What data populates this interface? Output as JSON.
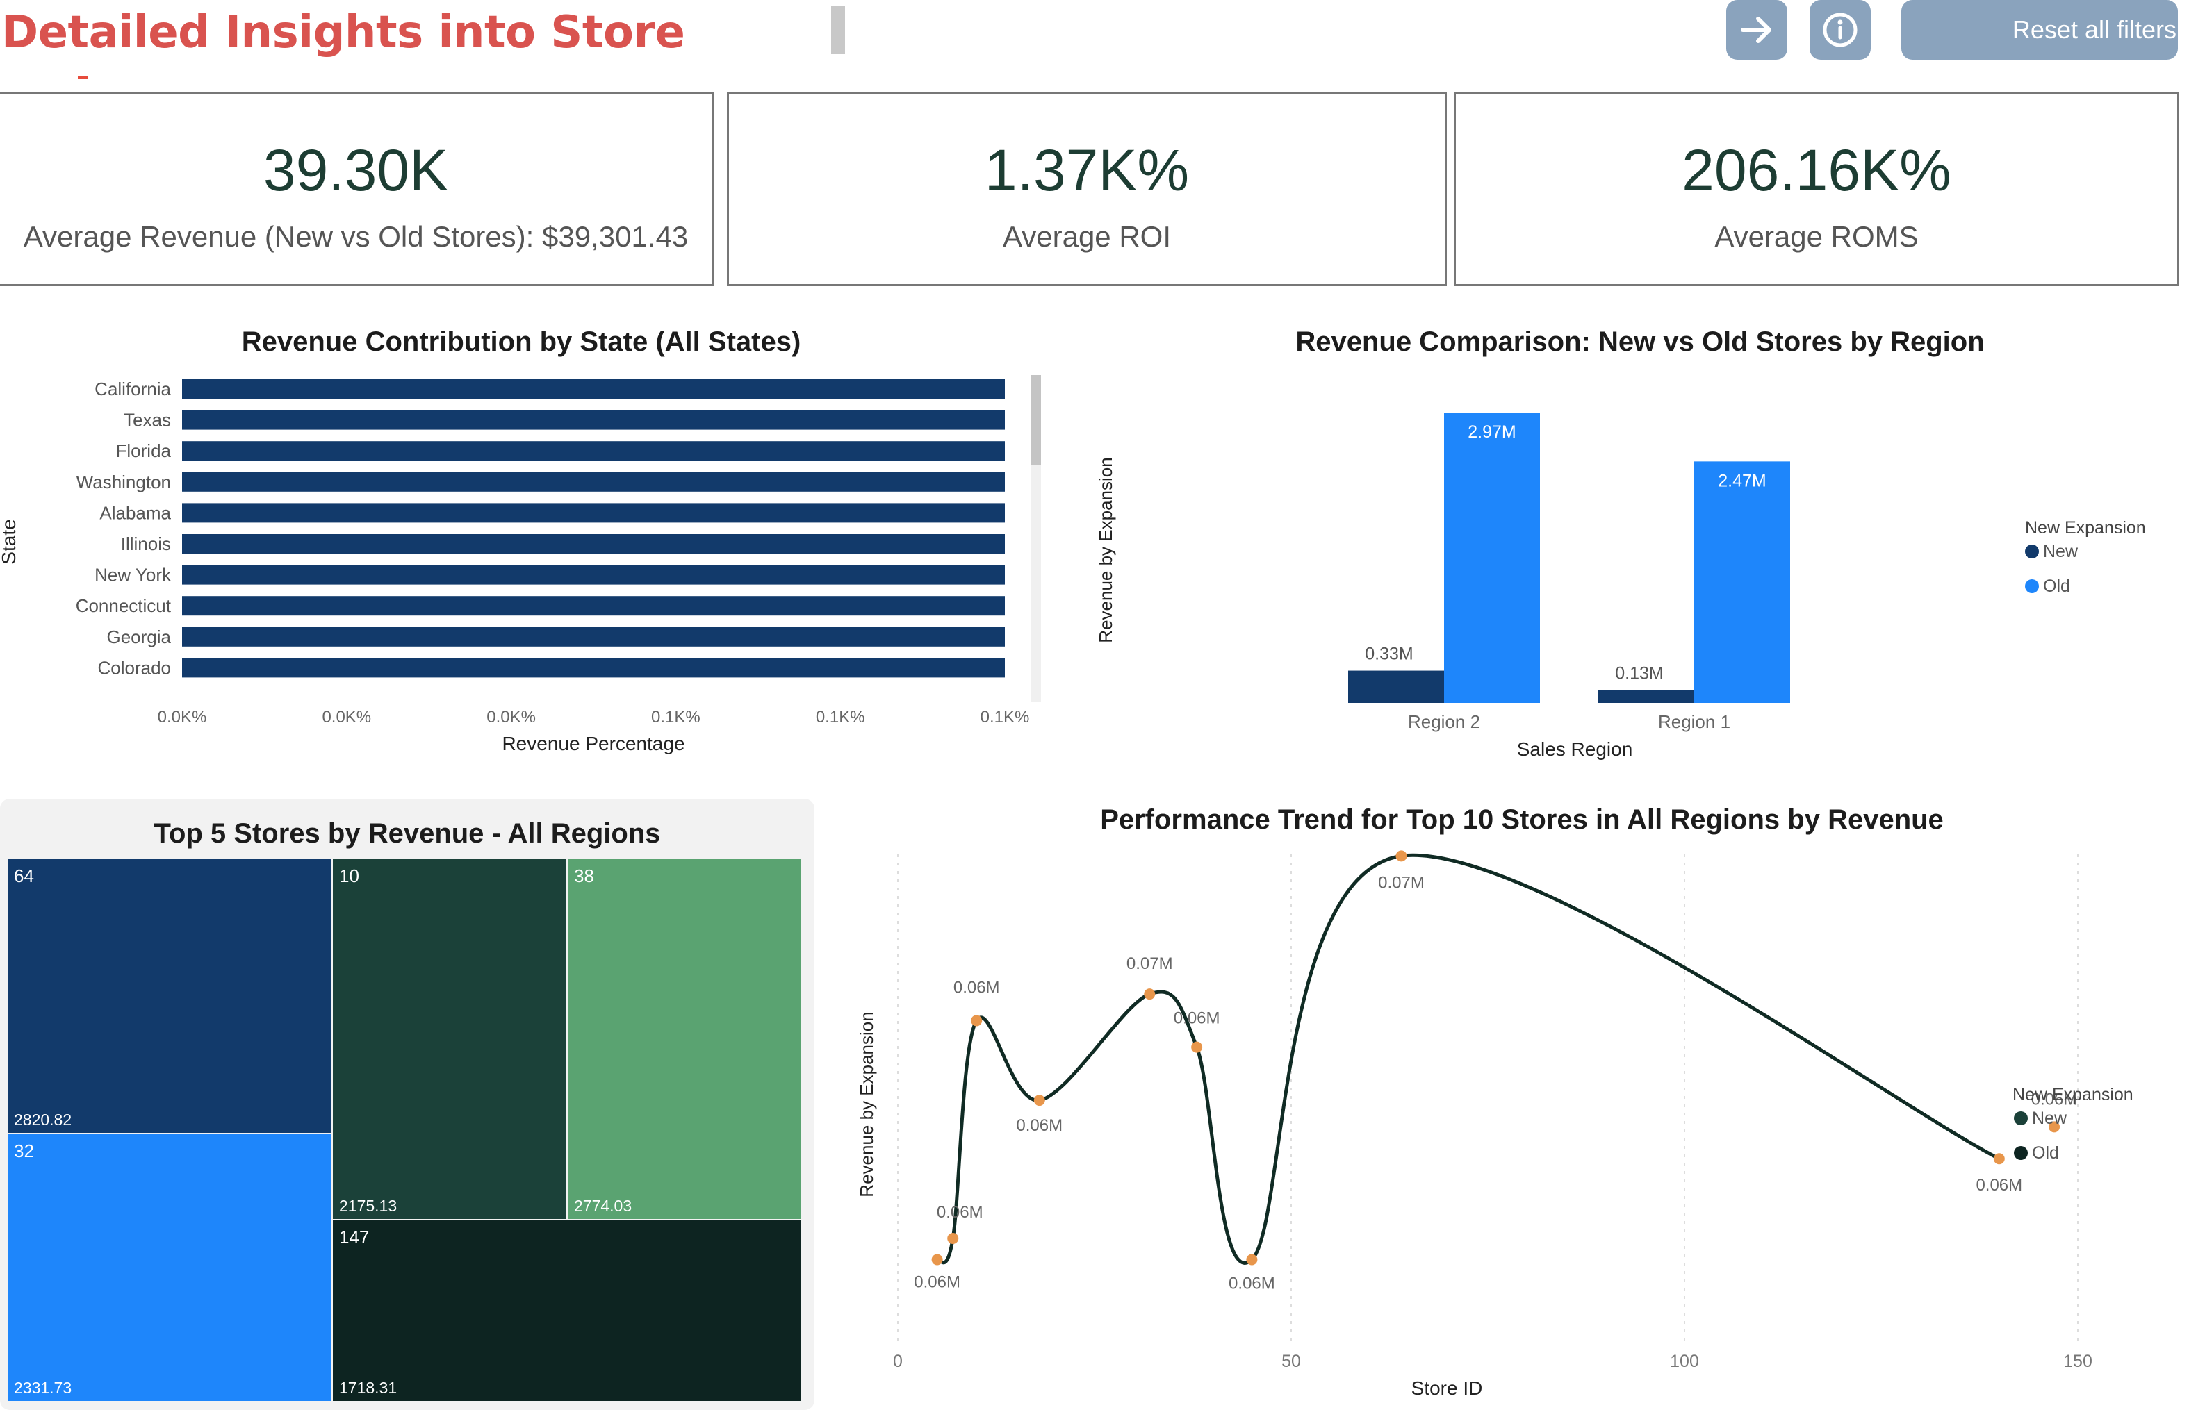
{
  "header": {
    "title": "Detailed Insights into Store",
    "reset_label": "Reset all filters",
    "nav_icon": "arrow-right-icon",
    "info_icon": "info-icon"
  },
  "kpis": [
    {
      "value": "39.30K",
      "label": "Average Revenue (New vs Old Stores): $39,301.43"
    },
    {
      "value": "1.37K%",
      "label": "Average ROI"
    },
    {
      "value": "206.16K%",
      "label": "Average ROMS"
    }
  ],
  "colors": {
    "title_red": "#d9534f",
    "navy": "#123a6b",
    "bright_blue": "#1e86fb",
    "line_dark": "#102b24",
    "point_orange": "#e8964b",
    "tm_dark_green": "#1b4139",
    "tm_light_green": "#5aa371",
    "tm_darkest": "#0d2421"
  },
  "chart_data": [
    {
      "type": "bar",
      "orientation": "horizontal",
      "title": "Revenue Contribution by State (All States)",
      "xlabel": "Revenue Percentage",
      "ylabel": "State",
      "categories": [
        "California",
        "Texas",
        "Florida",
        "Washington",
        "Alabama",
        "Illinois",
        "New York",
        "Connecticut",
        "Georgia",
        "Colorado"
      ],
      "values": [
        0.1,
        0.1,
        0.1,
        0.1,
        0.1,
        0.1,
        0.1,
        0.1,
        0.1,
        0.1
      ],
      "xticks": [
        "0.0K%",
        "0.0K%",
        "0.0K%",
        "0.1K%",
        "0.1K%",
        "0.1K%"
      ],
      "grid": false
    },
    {
      "type": "bar",
      "title": "Revenue Comparison: New vs Old Stores by Region",
      "xlabel": "Sales Region",
      "ylabel": "Revenue by Expansion",
      "categories": [
        "Region 2",
        "Region 1"
      ],
      "legend_title": "New Expansion",
      "legend_position": "right",
      "series": [
        {
          "name": "New",
          "values": [
            0.33,
            0.13
          ],
          "labels": [
            "0.33M",
            "0.13M"
          ]
        },
        {
          "name": "Old",
          "values": [
            2.97,
            2.47
          ],
          "labels": [
            "2.97M",
            "2.47M"
          ]
        }
      ],
      "ylim": [
        0,
        3.4
      ]
    },
    {
      "type": "treemap",
      "title": "Top 5 Stores by Revenue - All Regions",
      "items": [
        {
          "store": "64",
          "value": 2820.82
        },
        {
          "store": "32",
          "value": 2331.73
        },
        {
          "store": "10",
          "value": 2175.13
        },
        {
          "store": "38",
          "value": 2774.03
        },
        {
          "store": "147",
          "value": 1718.31
        }
      ]
    },
    {
      "type": "line",
      "title": "Performance Trend for Top 10 Stores in All Regions by Revenue",
      "xlabel": "Store ID",
      "ylabel": "Revenue by Expansion",
      "legend_title": "New Expansion",
      "legend_position": "right",
      "xlim": [
        0,
        150
      ],
      "ylim": [
        0.055,
        0.072
      ],
      "xticks": [
        "0",
        "50",
        "100",
        "150"
      ],
      "series": [
        {
          "name": "New",
          "x": [
            5,
            7,
            10,
            18,
            32,
            38,
            45,
            64,
            140
          ],
          "y": [
            0.057,
            0.0578,
            0.066,
            0.063,
            0.067,
            0.065,
            0.057,
            0.0722,
            0.0608
          ],
          "labels": [
            "0.06M",
            "0.06M",
            "0.06M",
            "0.06M",
            "0.07M",
            "0.06M",
            "0.06M",
            "0.07M",
            "0.06M"
          ]
        },
        {
          "name": "Old",
          "x": [
            147
          ],
          "y": [
            0.062
          ],
          "labels": [
            "0.06M"
          ]
        }
      ]
    }
  ]
}
